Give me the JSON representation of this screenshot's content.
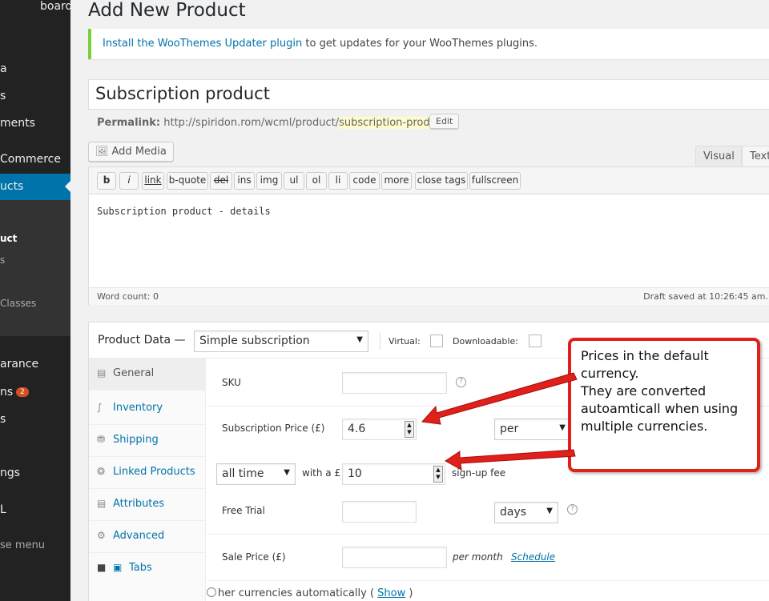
{
  "sidebar": {
    "items": [
      {
        "label": "board"
      },
      {
        "label": "a"
      },
      {
        "label": "s"
      },
      {
        "label": "ments"
      },
      {
        "label": "Commerce"
      },
      {
        "label": "ucts"
      },
      {
        "label": "uct"
      },
      {
        "label": "s"
      },
      {
        "label": "Classes"
      },
      {
        "label": "arance"
      },
      {
        "label": "ns"
      },
      {
        "label": "s"
      },
      {
        "label": "ngs"
      },
      {
        "label": "L"
      },
      {
        "label": "se menu"
      }
    ],
    "plugins_badge": "2"
  },
  "page": {
    "title": "Add New Product"
  },
  "notice": {
    "link": "Install the WooThemes Updater plugin",
    "text": " to get updates for your WooThemes plugins."
  },
  "post": {
    "title_value": "Subscription product",
    "permalink_label": "Permalink:",
    "permalink_base": " http://spiridon.rom/wcml/product/",
    "permalink_slug": "subscription-product",
    "permalink_trail": "/",
    "edit_label": "Edit",
    "add_media_label": "Add Media"
  },
  "editor": {
    "tab_visual": "Visual",
    "tab_text": "Text",
    "quicktags": [
      "b",
      "i",
      "link",
      "b-quote",
      "del",
      "ins",
      "img",
      "ul",
      "ol",
      "li",
      "code",
      "more",
      "close tags",
      "fullscreen"
    ],
    "content": "Subscription product - details",
    "word_count": "Word count: 0",
    "draft_saved": "Draft saved at 10:26:45 am."
  },
  "product_data": {
    "title": "Product Data —",
    "type_value": "Simple subscription",
    "virtual_label": "Virtual:",
    "downloadable_label": "Downloadable:",
    "tabs": [
      "General",
      "Inventory",
      "Shipping",
      "Linked Products",
      "Attributes",
      "Advanced",
      "Tabs"
    ],
    "sku_label": "SKU",
    "sku_value": "",
    "sub_price_label": "Subscription Price (£)",
    "sub_price_value": "4.6",
    "per_value": "per",
    "length_value": "all time",
    "with_a_label": "with a £",
    "signup_fee_value": "10",
    "signup_fee_label": "sign-up fee",
    "free_trial_label": "Free Trial",
    "free_trial_value": "",
    "trial_period_value": "days",
    "sale_price_label": "Sale Price (£)",
    "sale_price_value": "",
    "per_month_label": "per month",
    "schedule_label": "Schedule",
    "currencies_text": "her currencies automatically",
    "show_open": " ( ",
    "show_link": "Show",
    "show_close": " )"
  },
  "annotation": {
    "text_line1": "Prices in the default currency.",
    "text_line2": "They are converted autoamticall when using multiple currencies.",
    "color": "#e0201b"
  }
}
